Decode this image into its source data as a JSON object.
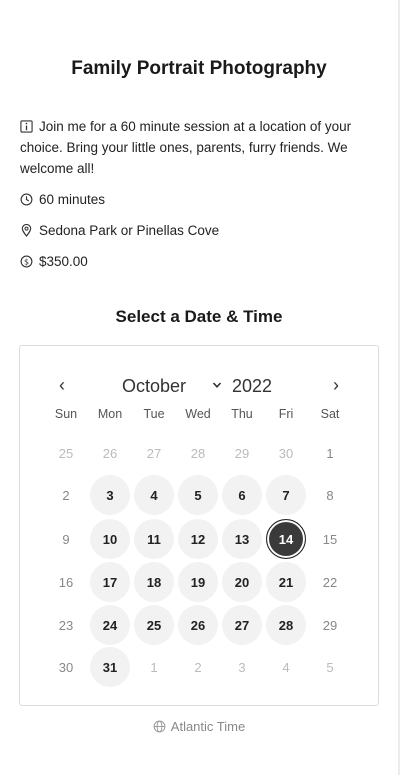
{
  "event": {
    "title": "Family Portrait Photography",
    "description": "Join me for a 60 minute session at a location of your choice. Bring your little ones, parents, furry friends. We welcome all!",
    "duration": "60 minutes",
    "location": "Sedona Park or Pinellas Cove",
    "price": "$350.00"
  },
  "icons": {
    "description": "info-icon",
    "duration": "clock-icon",
    "location": "map-pin-icon",
    "price": "dollar-icon",
    "timezone": "globe-icon"
  },
  "calendar": {
    "section_title": "Select a Date & Time",
    "month": "October",
    "year": "2022",
    "prev_label": "‹",
    "next_label": "›",
    "weekdays": [
      "Sun",
      "Mon",
      "Tue",
      "Wed",
      "Thu",
      "Fri",
      "Sat"
    ],
    "weeks": [
      [
        {
          "d": "25",
          "s": "other"
        },
        {
          "d": "26",
          "s": "other"
        },
        {
          "d": "27",
          "s": "other"
        },
        {
          "d": "28",
          "s": "other"
        },
        {
          "d": "29",
          "s": "other"
        },
        {
          "d": "30",
          "s": "other"
        },
        {
          "d": "1",
          "s": "unavailable"
        }
      ],
      [
        {
          "d": "2",
          "s": "unavailable"
        },
        {
          "d": "3",
          "s": "available"
        },
        {
          "d": "4",
          "s": "available"
        },
        {
          "d": "5",
          "s": "available"
        },
        {
          "d": "6",
          "s": "available"
        },
        {
          "d": "7",
          "s": "available"
        },
        {
          "d": "8",
          "s": "unavailable"
        }
      ],
      [
        {
          "d": "9",
          "s": "unavailable"
        },
        {
          "d": "10",
          "s": "available"
        },
        {
          "d": "11",
          "s": "available"
        },
        {
          "d": "12",
          "s": "available"
        },
        {
          "d": "13",
          "s": "available"
        },
        {
          "d": "14",
          "s": "selected"
        },
        {
          "d": "15",
          "s": "unavailable"
        }
      ],
      [
        {
          "d": "16",
          "s": "unavailable"
        },
        {
          "d": "17",
          "s": "available"
        },
        {
          "d": "18",
          "s": "available"
        },
        {
          "d": "19",
          "s": "available"
        },
        {
          "d": "20",
          "s": "available"
        },
        {
          "d": "21",
          "s": "available"
        },
        {
          "d": "22",
          "s": "unavailable"
        }
      ],
      [
        {
          "d": "23",
          "s": "unavailable"
        },
        {
          "d": "24",
          "s": "available"
        },
        {
          "d": "25",
          "s": "available"
        },
        {
          "d": "26",
          "s": "available"
        },
        {
          "d": "27",
          "s": "available"
        },
        {
          "d": "28",
          "s": "available"
        },
        {
          "d": "29",
          "s": "unavailable"
        }
      ],
      [
        {
          "d": "30",
          "s": "unavailable"
        },
        {
          "d": "31",
          "s": "available"
        },
        {
          "d": "1",
          "s": "other"
        },
        {
          "d": "2",
          "s": "other"
        },
        {
          "d": "3",
          "s": "other"
        },
        {
          "d": "4",
          "s": "other"
        },
        {
          "d": "5",
          "s": "other"
        }
      ]
    ]
  },
  "timezone": "Atlantic Time",
  "colors": {
    "selected_day": "#3a3a3a",
    "available_day": "#f2f2f2"
  }
}
